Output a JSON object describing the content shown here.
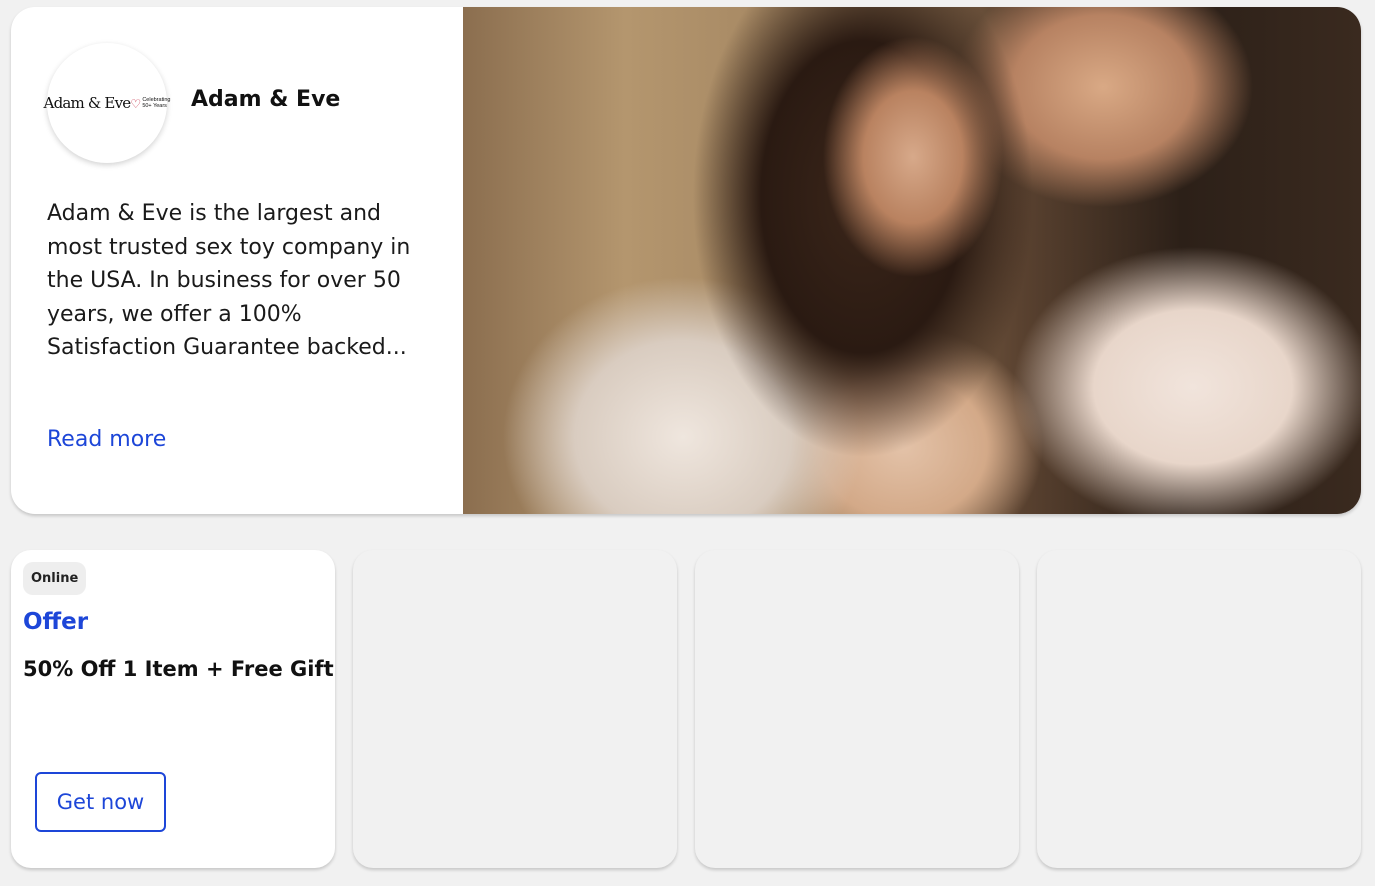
{
  "brand": {
    "name": "Adam & Eve",
    "logo_text": "Adam & Eve",
    "logo_sub_1": "Celebrating",
    "logo_sub_2": "50+ Years",
    "description": "Adam & Eve is the largest and most trusted sex toy company in the USA. In business for over 50 years, we offer a 100% Satisfaction Guarantee backed...",
    "read_more_label": "Read more"
  },
  "offers": [
    {
      "tag": "Online",
      "type": "Offer",
      "title": "50% Off 1 Item + Free Gift",
      "button_label": "Get now"
    }
  ],
  "colors": {
    "accent": "#1d46d8",
    "background": "#f1f1f1",
    "card": "#ffffff"
  }
}
